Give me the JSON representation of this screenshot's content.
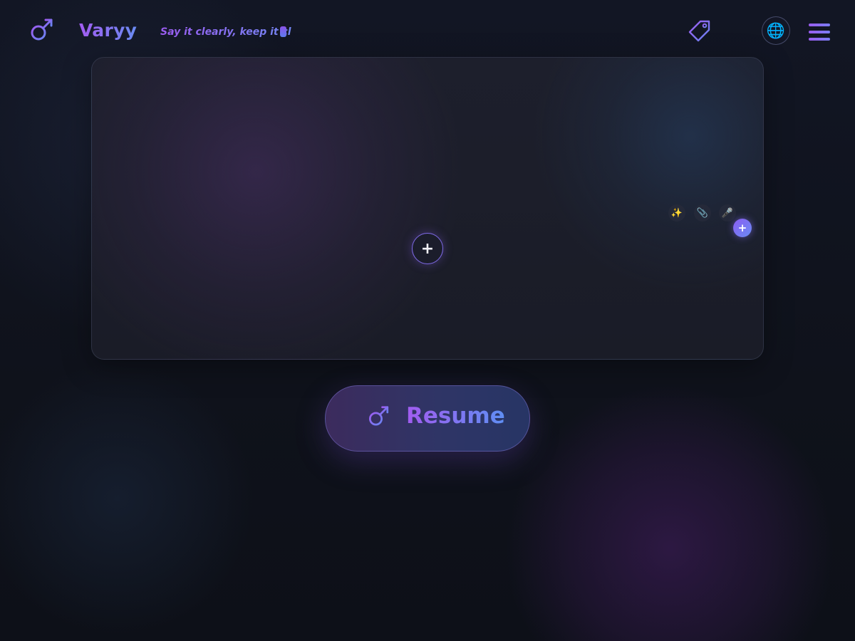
{
  "header": {
    "logo_icon": "mars-venus-symbol-icon",
    "brand": "Varyy",
    "tagline": "Say it clearly, keep it cl",
    "tag_icon": "price-tag-icon",
    "globe_icon": "🌐",
    "menu_icon": "hamburger-menu-icon"
  },
  "editor": {
    "center_add_label": "+",
    "tools": {
      "sparkle": "✨",
      "attach": "📎",
      "mic": "🎤"
    },
    "corner_add_label": "+"
  },
  "resume": {
    "icon": "mars-venus-symbol-icon",
    "label": "Resume"
  },
  "colors": {
    "accent_purple": "#a25cf0",
    "accent_blue": "#5f8ef3",
    "background": "#10131d"
  }
}
